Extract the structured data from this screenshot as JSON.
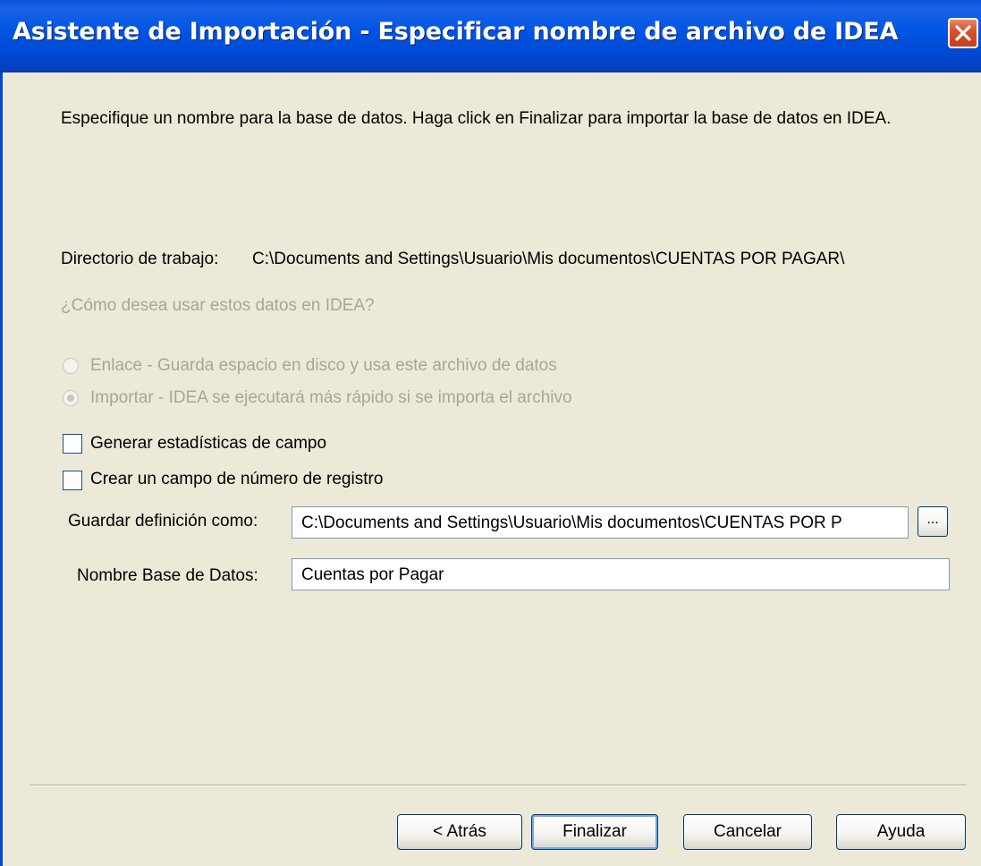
{
  "window": {
    "title": "Asistente de Importación - Especificar nombre de archivo de IDEA",
    "close_icon": "close-icon"
  },
  "instructions": "Especifique un nombre para la base de datos. Haga click en Finalizar para importar la base de datos en IDEA.",
  "working_dir": {
    "label": "Directorio de trabajo:",
    "value": "C:\\Documents and Settings\\Usuario\\Mis documentos\\CUENTAS POR PAGAR\\"
  },
  "usage": {
    "question": "¿Cómo desea usar estos datos en IDEA?",
    "options": [
      {
        "label": "Enlace - Guarda espacio en disco y usa este archivo de datos",
        "selected": false,
        "enabled": false
      },
      {
        "label": "Importar - IDEA se ejecutará más rápido si se importa el archivo",
        "selected": true,
        "enabled": false
      }
    ]
  },
  "checkboxes": [
    {
      "label": "Generar estadísticas de campo",
      "checked": false
    },
    {
      "label": "Crear un campo de número de registro",
      "checked": false
    }
  ],
  "save_definition": {
    "label": "Guardar definición como:",
    "value": "C:\\Documents and Settings\\Usuario\\Mis documentos\\CUENTAS POR P",
    "browse_label": "..."
  },
  "database_name": {
    "label": "Nombre Base de Datos:",
    "value": "Cuentas por Pagar"
  },
  "buttons": {
    "back": "< Atrás",
    "finish": "Finalizar",
    "cancel": "Cancelar",
    "help": "Ayuda"
  },
  "colors": {
    "titlebar": "#0054E3",
    "dialog_bg": "#ECE9D8",
    "disabled_text": "#A7A694",
    "close_button": "#D8532E"
  }
}
